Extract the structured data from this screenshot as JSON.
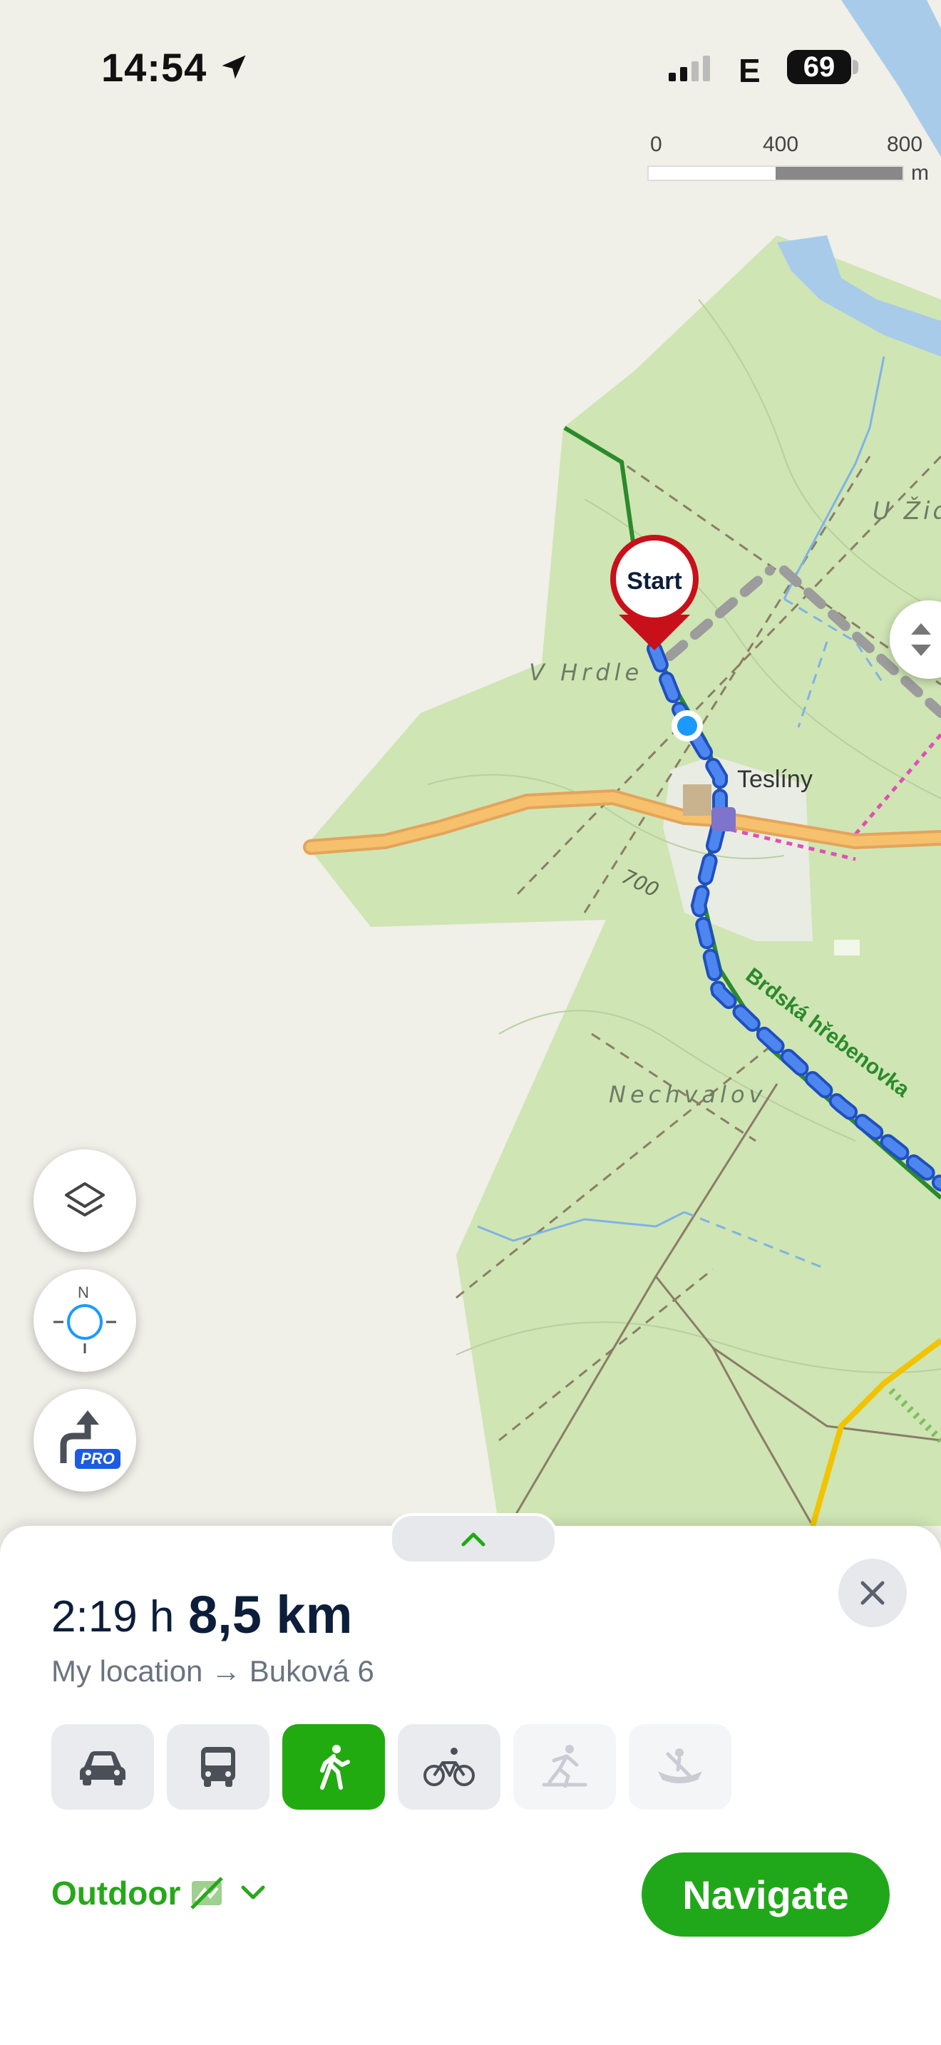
{
  "status_bar": {
    "time": "14:54",
    "network": "E",
    "battery": "69"
  },
  "scale_bar": {
    "labels": [
      "0",
      "400",
      "800"
    ],
    "unit": "m"
  },
  "map": {
    "labels": {
      "start_marker": "Start",
      "u_zid": "U Žid",
      "v_hrdle": "V Hrdle",
      "tesliny": "Teslíny",
      "contour": "700",
      "trail": "Brdská hřebenovka",
      "nechvalov": "Nechvalov"
    }
  },
  "map_controls": {
    "layers_icon": "layers-icon",
    "compass_icon": "compass-icon",
    "compass_letter": "N",
    "pro_badge": "PRO"
  },
  "route_panel": {
    "duration_value": "2:19",
    "duration_unit": "h",
    "distance": "8,5 km",
    "from": "My location",
    "arrow": "→",
    "to": "Buková 6",
    "modes": [
      {
        "name": "car",
        "icon": "car-icon",
        "state": "normal"
      },
      {
        "name": "bus",
        "icon": "bus-icon",
        "state": "normal"
      },
      {
        "name": "walk",
        "icon": "walk-icon",
        "state": "active"
      },
      {
        "name": "bike",
        "icon": "bike-icon",
        "state": "normal"
      },
      {
        "name": "ski",
        "icon": "ski-icon",
        "state": "disabled"
      },
      {
        "name": "boat",
        "icon": "boat-icon",
        "state": "disabled"
      }
    ],
    "profile_label": "Outdoor",
    "navigate_label": "Navigate"
  },
  "colors": {
    "accent": "#22aa11",
    "dark_text": "#0c1e3a",
    "route_blue": "#3b78f0",
    "start_red": "#d11a1a"
  }
}
